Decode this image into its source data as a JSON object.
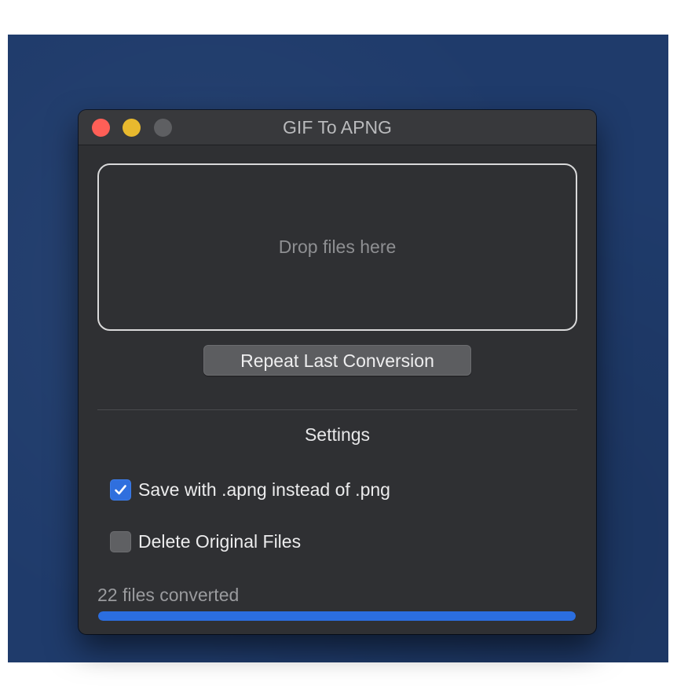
{
  "window": {
    "title": "GIF To APNG"
  },
  "dropzone": {
    "label": "Drop files here"
  },
  "actions": {
    "repeat_label": "Repeat Last Conversion"
  },
  "settings": {
    "heading": "Settings",
    "options": [
      {
        "label": "Save with .apng instead of .png",
        "checked": true
      },
      {
        "label": "Delete Original Files",
        "checked": false
      }
    ]
  },
  "status": {
    "text": "22 files converted",
    "progress_fraction": 1.0
  },
  "colors": {
    "accent": "#2b6ee0",
    "close": "#ff5f57",
    "minimize": "#e8b92e",
    "zoom_inactive": "#5e5f62",
    "desktop": "#1f3b6b"
  },
  "icons": {
    "checkmark": "checkmark-icon"
  }
}
